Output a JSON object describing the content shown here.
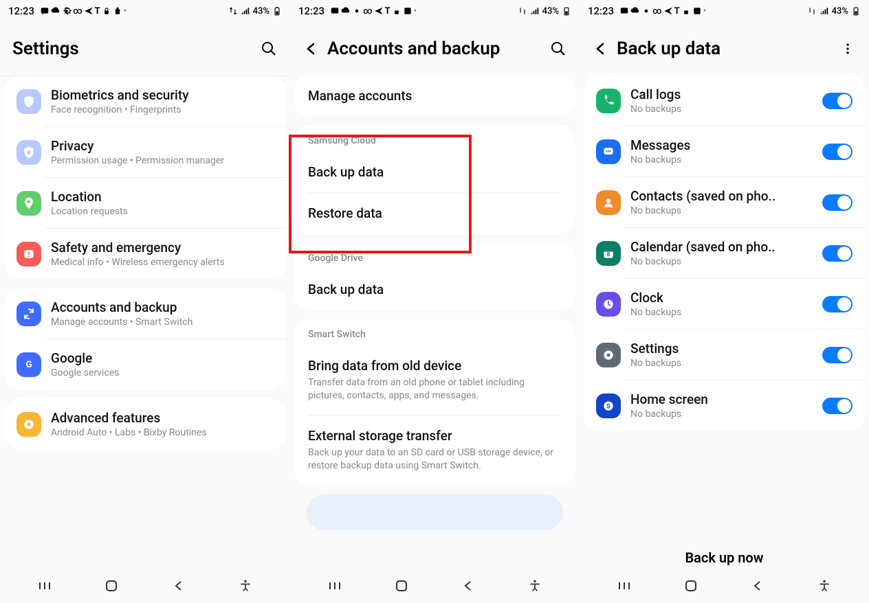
{
  "status": {
    "time": "12:23",
    "battery": "43%"
  },
  "screen1": {
    "title": "Settings",
    "items": [
      {
        "label": "Biometrics and security",
        "sub": "Face recognition  •  Fingerprints"
      },
      {
        "label": "Privacy",
        "sub": "Permission usage  •  Permission manager"
      },
      {
        "label": "Location",
        "sub": "Location requests"
      },
      {
        "label": "Safety and emergency",
        "sub": "Medical info  •  Wireless emergency alerts"
      },
      {
        "label": "Accounts and backup",
        "sub": "Manage accounts  •  Smart Switch"
      },
      {
        "label": "Google",
        "sub": "Google services"
      },
      {
        "label": "Advanced features",
        "sub": "Android Auto  •  Labs  •  Bixby Routines"
      }
    ]
  },
  "screen2": {
    "title": "Accounts and backup",
    "manage_accounts": "Manage accounts",
    "section_samsung": "Samsung Cloud",
    "back_up_data": "Back up data",
    "restore_data": "Restore data",
    "section_google": "Google Drive",
    "google_backup": "Back up data",
    "section_smart": "Smart Switch",
    "bring_title": "Bring data from old device",
    "bring_desc": "Transfer data from an old phone or tablet including pictures, contacts, apps, and messages.",
    "ext_title": "External storage transfer",
    "ext_desc": "Back up your data to an SD card or USB storage device, or restore backup data using Smart Switch."
  },
  "screen3": {
    "title": "Back up data",
    "no_backups": "No backups",
    "items": [
      {
        "label": "Call logs"
      },
      {
        "label": "Messages"
      },
      {
        "label": "Contacts (saved on pho.."
      },
      {
        "label": "Calendar (saved on pho.."
      },
      {
        "label": "Clock"
      },
      {
        "label": "Settings"
      },
      {
        "label": "Home screen"
      }
    ],
    "backup_now": "Back up now"
  }
}
